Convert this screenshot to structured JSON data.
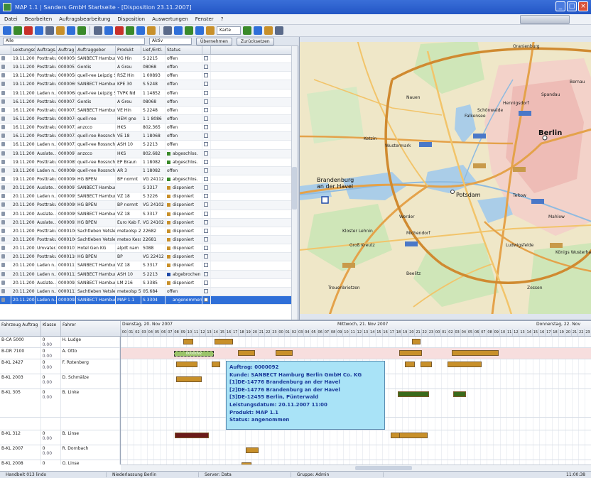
{
  "window": {
    "title": "MAP 1.1 | Sanders GmbH Startseite - [Disposition 23.11.2007]"
  },
  "menu": {
    "items": [
      "Datei",
      "Bearbeiten",
      "Auftragsbearbeitung",
      "Disposition",
      "Auswertungen",
      "Fenster",
      "?"
    ]
  },
  "toolbar": {
    "zoom_label": "Karte"
  },
  "filter": {
    "left_select": "Alle",
    "right_select": "Aktiv",
    "apply_label": "Übernehmen",
    "reset_label": "Zurücksetzen"
  },
  "grid": {
    "columns": [
      "",
      "Leistungsd...",
      "Auftrags...",
      "Auftrag",
      "Auftraggeber",
      "Produkt",
      "Lief./Entl.",
      "Status",
      ""
    ],
    "rows": [
      {
        "date": "19.11.2007",
        "type": "Posttraku",
        "nr": "0000050",
        "client": "SANBECT Hamburg...",
        "product": "VG Hin",
        "ort": "S 2215",
        "status": "offen",
        "color": ""
      },
      {
        "date": "19.11.2007",
        "type": "Posttraku",
        "nr": "0000057",
        "client": "Gordis",
        "product": "A Greu",
        "ort": "08068",
        "status": "offen",
        "color": ""
      },
      {
        "date": "19.11.2007",
        "type": "Posttraku",
        "nr": "0000058",
        "client": "quell-ree Leipzig S...",
        "product": "RSZ Hin",
        "ort": "1 00893",
        "status": "offen",
        "color": ""
      },
      {
        "date": "19.11.2007",
        "type": "Posttraku",
        "nr": "0000069",
        "client": "SANBECT Hamburg...",
        "product": "KPE 30",
        "ort": "S 5248",
        "status": "offen",
        "color": ""
      },
      {
        "date": "19.11.2007",
        "type": "Laden n...",
        "nr": "0000068",
        "client": "quell-ree Leipzig S...",
        "product": "TVPK Nd",
        "ort": "1 14852",
        "status": "offen",
        "color": ""
      },
      {
        "date": "16.11.2007",
        "type": "Posttraku",
        "nr": "0000071",
        "client": "Gordis",
        "product": "A Greu",
        "ort": "08068",
        "status": "offen",
        "color": ""
      },
      {
        "date": "16.11.2007",
        "type": "Posttraku",
        "nr": "0000072",
        "client": "SANBECT Hamburg...",
        "product": "VE Hin",
        "ort": "S 2248",
        "status": "offen",
        "color": ""
      },
      {
        "date": "16.11.2007",
        "type": "Posttraku",
        "nr": "0000074",
        "client": "quell-ree",
        "product": "HEM gne",
        "ort": "1 1 8086",
        "status": "offen",
        "color": ""
      },
      {
        "date": "16.11.2007",
        "type": "Posttraku",
        "nr": "0000072",
        "client": "anzcco",
        "product": "HKS",
        "ort": "802.365",
        "status": "offen",
        "color": ""
      },
      {
        "date": "16.11.2007",
        "type": "Posttraku",
        "nr": "0000073",
        "client": "quell-ree Rossnch S...",
        "product": "VE 18",
        "ort": "1 18068",
        "status": "offen",
        "color": ""
      },
      {
        "date": "16.11.2007",
        "type": "Laden n...",
        "nr": "0000073",
        "client": "quell-ree Rossnch S...",
        "product": "ASH 10",
        "ort": "S 2213",
        "status": "offen",
        "color": ""
      },
      {
        "date": "19.11.2007",
        "type": "Auslate...",
        "nr": "0000097",
        "client": "anzcco",
        "product": "HKS",
        "ort": "802.682",
        "status": "abgeschlos.",
        "color": "#3a8a2a"
      },
      {
        "date": "19.11.2007",
        "type": "Posttraku",
        "nr": "0000085",
        "client": "quell-ree Rossnch S...",
        "product": "EP Braun",
        "ort": "1 18082",
        "status": "abgeschlos.",
        "color": "#3a8a2a"
      },
      {
        "date": "19.11.2007",
        "type": "Laden n...",
        "nr": "0000086",
        "client": "quell-ree Rossnch S...",
        "product": "AR 3",
        "ort": "1 18082",
        "status": "offen",
        "color": ""
      },
      {
        "date": "19.11.2007",
        "type": "Posttraku",
        "nr": "0000096",
        "client": "HG BPEN",
        "product": "BP nomnt",
        "ort": "VG 24112",
        "status": "abgeschlos.",
        "color": "#3a8a2a"
      },
      {
        "date": "20.11.2007",
        "type": "Auslate...",
        "nr": "0000097",
        "client": "SANBECT Hamburg...",
        "product": "",
        "ort": "S 3317",
        "status": "disponiert",
        "color": "#c8902a"
      },
      {
        "date": "20.11.2007",
        "type": "Laden n...",
        "nr": "0000095",
        "client": "SANBECT Hamburg...",
        "product": "VZ 18",
        "ort": "S 3226",
        "status": "disponiert",
        "color": "#c8902a"
      },
      {
        "date": "20.11.2007",
        "type": "Posttraku",
        "nr": "0000098",
        "client": "HG BPEN",
        "product": "BP nomnt",
        "ort": "VG 24102",
        "status": "disponiert",
        "color": "#c8902a"
      },
      {
        "date": "20.11.2007",
        "type": "Auslate...",
        "nr": "0000099",
        "client": "SANBECT Hamburg...",
        "product": "VZ 18",
        "ort": "S 3317",
        "status": "disponiert",
        "color": "#c8902a"
      },
      {
        "date": "20.11.2007",
        "type": "Auslate...",
        "nr": "0000093",
        "client": "HG BPEN",
        "product": "Euro Kab F...",
        "ort": "VG 24102",
        "status": "disponiert",
        "color": "#c8902a"
      },
      {
        "date": "20.11.2007",
        "type": "Posttraku",
        "nr": "0000106",
        "client": "Sachtleben Vetsle...",
        "product": "meteolsp 2...",
        "ort": "22682",
        "status": "disponiert",
        "color": "#c8902a"
      },
      {
        "date": "20.11.2007",
        "type": "Posttraku",
        "nr": "0000106",
        "client": "Sachtleben Vetsle...",
        "product": "meteo Kess...",
        "ort": "22681",
        "status": "disponiert",
        "color": "#c8902a"
      },
      {
        "date": "20.11.2007",
        "type": "Umvater...",
        "nr": "0000107",
        "client": "Hotel Gen KG",
        "product": "alpdt nam",
        "ort": "5088",
        "status": "disponiert",
        "color": "#c8902a"
      },
      {
        "date": "20.11.2007",
        "type": "Posttraku",
        "nr": "0000110",
        "client": "HG BPEN",
        "product": "BP",
        "ort": "VG 22412",
        "status": "disponiert",
        "color": "#c8902a"
      },
      {
        "date": "20.11.2007",
        "type": "Laden n...",
        "nr": "0000111",
        "client": "SANBECT Hamburg...",
        "product": "VZ 18",
        "ort": "S 3317",
        "status": "disponiert",
        "color": "#c8902a"
      },
      {
        "date": "20.11.2007",
        "type": "Laden n...",
        "nr": "0000112",
        "client": "SANBECT Hamburg...",
        "product": "ASH 10",
        "ort": "S 2213",
        "status": "abgebrochen",
        "color": "#1f4aa8"
      },
      {
        "date": "20.11.2007",
        "type": "Auslate...",
        "nr": "0000093",
        "client": "SANBECT Hamburg...",
        "product": "LM 216",
        "ort": "S 3385",
        "status": "disponiert",
        "color": "#c8902a"
      },
      {
        "date": "20.11.2007",
        "type": "Laden n...",
        "nr": "0000113",
        "client": "Sachtleben Vetsle...",
        "product": "meteolsp 5...",
        "ort": "05.684",
        "status": "offen",
        "color": ""
      },
      {
        "date": "20.11.2007",
        "type": "Laden n...",
        "nr": "0000092",
        "client": "SANBECT Hamburg...",
        "product": "MAP 1.1",
        "ort": "S 3304",
        "status": "angenommen",
        "color": "#2f6fd8",
        "selected": true
      }
    ]
  },
  "map": {
    "labels": [
      {
        "text": "Berlin",
        "cls": "big"
      },
      {
        "text": "Potsdam",
        "cls": "mid"
      },
      {
        "text": "Brandenburg an der Havel",
        "cls": "mid"
      },
      {
        "text": "Spandau",
        "cls": ""
      },
      {
        "text": "Hennigsdorf",
        "cls": ""
      },
      {
        "text": "Schönwalde",
        "cls": ""
      },
      {
        "text": "Falkensee",
        "cls": ""
      },
      {
        "text": "Nauen",
        "cls": ""
      },
      {
        "text": "Werder",
        "cls": ""
      },
      {
        "text": "Michendorf",
        "cls": ""
      },
      {
        "text": "Beelitz",
        "cls": ""
      },
      {
        "text": "Ludwigsfelde",
        "cls": ""
      },
      {
        "text": "Königs Wusterhausen",
        "cls": ""
      },
      {
        "text": "Teltow",
        "cls": ""
      },
      {
        "text": "Oranienburg",
        "cls": ""
      },
      {
        "text": "Bernau",
        "cls": ""
      },
      {
        "text": "Zossen",
        "cls": ""
      },
      {
        "text": "Kloster Lehnin",
        "cls": ""
      },
      {
        "text": "Groß Kreutz",
        "cls": ""
      },
      {
        "text": "Ketzin",
        "cls": ""
      },
      {
        "text": "Wustermark",
        "cls": ""
      },
      {
        "text": "Mahlow",
        "cls": ""
      },
      {
        "text": "Treuenbrietzen",
        "cls": ""
      }
    ]
  },
  "schedule": {
    "headers": [
      "Fahrzeug Auftrag",
      "Klasse",
      "Fahrer"
    ],
    "day1": "Dienstag, 20. Nov 2007",
    "day2": "Mittwoch, 21. Nov 2007",
    "day3": "Donnerstag, 22. Nov",
    "hours": [
      "00",
      "01",
      "02",
      "03",
      "04",
      "05",
      "06",
      "07",
      "08",
      "09",
      "10",
      "11",
      "12",
      "13",
      "14",
      "15",
      "16",
      "17",
      "18",
      "19",
      "20",
      "21",
      "22",
      "23",
      "00",
      "01",
      "02",
      "03",
      "04",
      "05",
      "06",
      "07",
      "08",
      "09",
      "10",
      "11",
      "12",
      "13",
      "14",
      "15",
      "16",
      "17",
      "18",
      "19",
      "20",
      "21",
      "22",
      "23",
      "00",
      "01",
      "02",
      "03",
      "04",
      "05",
      "06",
      "07",
      "08",
      "09",
      "10",
      "11",
      "12",
      "13",
      "14",
      "15",
      "16",
      "17",
      "18",
      "19",
      "20",
      "21",
      "22",
      "23"
    ],
    "vehicles": [
      {
        "plate": "B-CA 5000",
        "klasse": "0",
        "sub": "0.00",
        "fahrer": "H. Ludge"
      },
      {
        "plate": "B-DR 7100",
        "klasse": "0",
        "sub": "0.00",
        "fahrer": "A. Otto"
      },
      {
        "plate": "B-KL 2427",
        "klasse": "0",
        "sub": "0.00",
        "fahrer": "F. Rotenberg"
      },
      {
        "plate": "B-KL 2003",
        "klasse": "0",
        "sub": "0.00",
        "fahrer": "D. Schmälze"
      },
      {
        "plate": "B-KL 305",
        "klasse": "0",
        "sub": "0.00",
        "fahrer": "B. Linke"
      },
      {
        "plate": "",
        "klasse": "",
        "sub": "",
        "fahrer": ""
      },
      {
        "plate": "B-KL 312",
        "klasse": "0",
        "sub": "0.00",
        "fahrer": "B. Linse"
      },
      {
        "plate": "B-KL 2007",
        "klasse": "0",
        "sub": "0.00",
        "fahrer": "R. Dornbach"
      },
      {
        "plate": "B-KL 2008",
        "klasse": "0",
        "sub": "0.00",
        "fahrer": "O. Linse"
      }
    ],
    "tooltip": [
      "Auftrag: 0000092",
      "Kunde: SANBECT Hamburg Berlin GmbH  Co. KG",
      "[1]DE-14776 Brandenburg an der Havel",
      "[2]DE-14776 Brandenburg an der Havel",
      "[3]DE-12455 Berlin, Pünterwald",
      "Leistungsdatum: 20.11.2007 11:00",
      "Produkt: MAP 1.1",
      "Status: angenommen"
    ],
    "selected_bar": "0000092"
  },
  "status": {
    "user": "Handbeit 013 lindo",
    "location": "Niederlassung Berlin",
    "server": "Server: Data",
    "role": "Gruppe: Admin",
    "time": "11:00:38"
  },
  "colors": {
    "accent": "#2f6fd8",
    "disponiert": "#c8902a",
    "abgeschlossen": "#3a8a2a",
    "tooltip": "#a9e3f7"
  }
}
